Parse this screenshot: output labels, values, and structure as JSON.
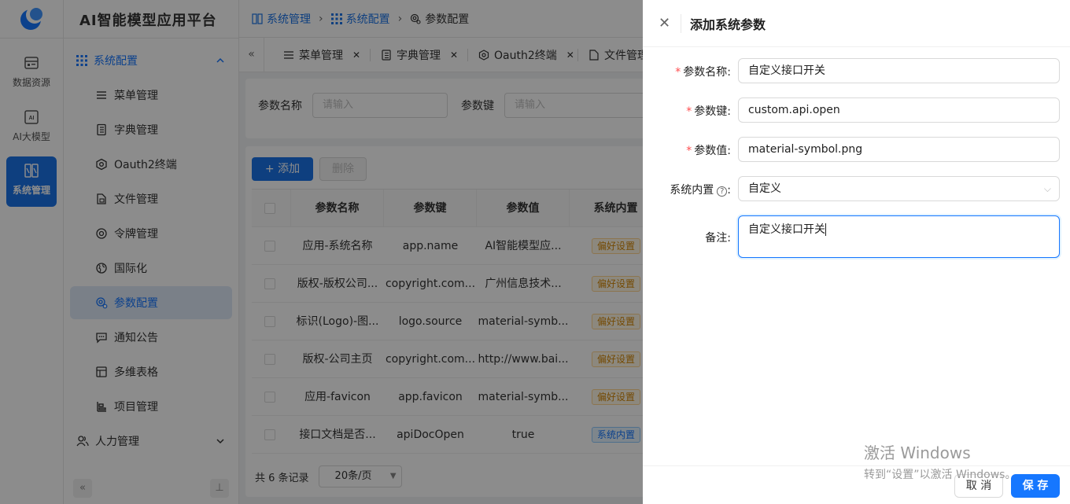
{
  "rail": {
    "items": [
      {
        "label": "数据资源",
        "icon": "database-icon"
      },
      {
        "label": "AI大模型",
        "icon": "ai-icon"
      },
      {
        "label": "系统管理",
        "icon": "system-icon"
      }
    ]
  },
  "sidebar": {
    "title": "AI智能模型应用平台",
    "group_system": "系统配置",
    "items": [
      {
        "label": "菜单管理",
        "icon": "menu-list-icon"
      },
      {
        "label": "字典管理",
        "icon": "dictionary-icon"
      },
      {
        "label": "Oauth2终端",
        "icon": "hexagon-icon"
      },
      {
        "label": "文件管理",
        "icon": "file-icon"
      },
      {
        "label": "令牌管理",
        "icon": "token-icon"
      },
      {
        "label": "国际化",
        "icon": "globe-icon"
      },
      {
        "label": "参数配置",
        "icon": "settings-icon"
      },
      {
        "label": "通知公告",
        "icon": "message-icon"
      },
      {
        "label": "多维表格",
        "icon": "table-icon"
      },
      {
        "label": "项目管理",
        "icon": "project-icon"
      }
    ],
    "group_hr": "人力管理"
  },
  "breadcrumb": [
    "系统管理",
    "系统配置",
    "参数配置"
  ],
  "tabs": [
    "菜单管理",
    "字典管理",
    "Oauth2终端",
    "文件管理"
  ],
  "filter": {
    "param_name_label": "参数名称",
    "param_name_placeholder": "请输入",
    "param_key_label": "参数键",
    "param_key_placeholder": "请输入"
  },
  "toolbar": {
    "add_label": "+ 添加",
    "delete_label": "删除"
  },
  "table": {
    "columns": [
      "参数名称",
      "参数键",
      "参数值",
      "系统内置"
    ],
    "rows": [
      {
        "name": "应用-系统名称",
        "key": "app.name",
        "value": "AI智能模型应...",
        "tag": "偏好设置",
        "tag_type": "pref"
      },
      {
        "name": "版权-版权公司...",
        "key": "copyright.com...",
        "value": "广州信息技术...",
        "tag": "偏好设置",
        "tag_type": "pref"
      },
      {
        "name": "标识(Logo)-图...",
        "key": "logo.source",
        "value": "material-symb...",
        "tag": "偏好设置",
        "tag_type": "pref"
      },
      {
        "name": "版权-公司主页",
        "key": "copyright.com...",
        "value": "http://www.bai...",
        "tag": "偏好设置",
        "tag_type": "pref"
      },
      {
        "name": "应用-favicon",
        "key": "app.favicon",
        "value": "material-symb...",
        "tag": "偏好设置",
        "tag_type": "pref"
      },
      {
        "name": "接口文档是否...",
        "key": "apiDocOpen",
        "value": "true",
        "tag": "系统内置",
        "tag_type": "sys"
      }
    ]
  },
  "pager": {
    "total": "共 6 条记录",
    "page_size": "20条/页"
  },
  "drawer": {
    "title": "添加系统参数",
    "fields": {
      "name_label": "参数名称:",
      "name_value": "自定义接口开关",
      "key_label": "参数键:",
      "key_value": "custom.api.open",
      "value_label": "参数值:",
      "value_value": "material-symbol.png",
      "builtin_label": "系统内置",
      "builtin_colon": ":",
      "builtin_value": "自定义",
      "remark_label": "备注:",
      "remark_value": "自定义接口开关"
    },
    "cancel_label": "取 消",
    "save_label": "保 存"
  },
  "watermark": {
    "line1": "激活 Windows",
    "line2": "转到“设置”以激活 Windows。"
  },
  "colors": {
    "primary": "#1677ff",
    "rail_active": "#1a73e8",
    "tag_pref": "#d48806",
    "tag_sys": "#1677ff"
  }
}
